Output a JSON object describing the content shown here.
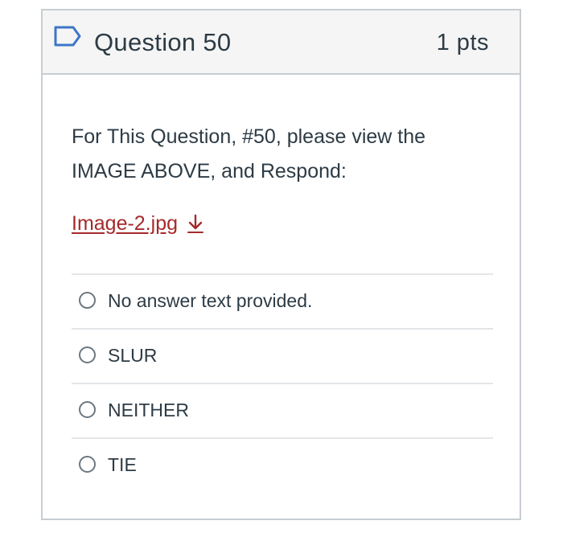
{
  "question": {
    "title": "Question 50",
    "points": "1 pts",
    "text": "For This Question, #50, please view the IMAGE ABOVE, and Respond:",
    "attachment": {
      "label": "Image-2.jpg",
      "icon": "download-arrow-icon"
    },
    "flag_icon": "flag-bookmark-icon"
  },
  "answers": [
    {
      "label": "No answer text provided.",
      "selected": false
    },
    {
      "label": "SLUR",
      "selected": false
    },
    {
      "label": "NEITHER",
      "selected": false
    },
    {
      "label": "TIE",
      "selected": false
    }
  ],
  "colors": {
    "accent_link": "#a52a2a",
    "flag": "#3e76c7",
    "border": "#c7cdd1",
    "text": "#2d3b45"
  }
}
